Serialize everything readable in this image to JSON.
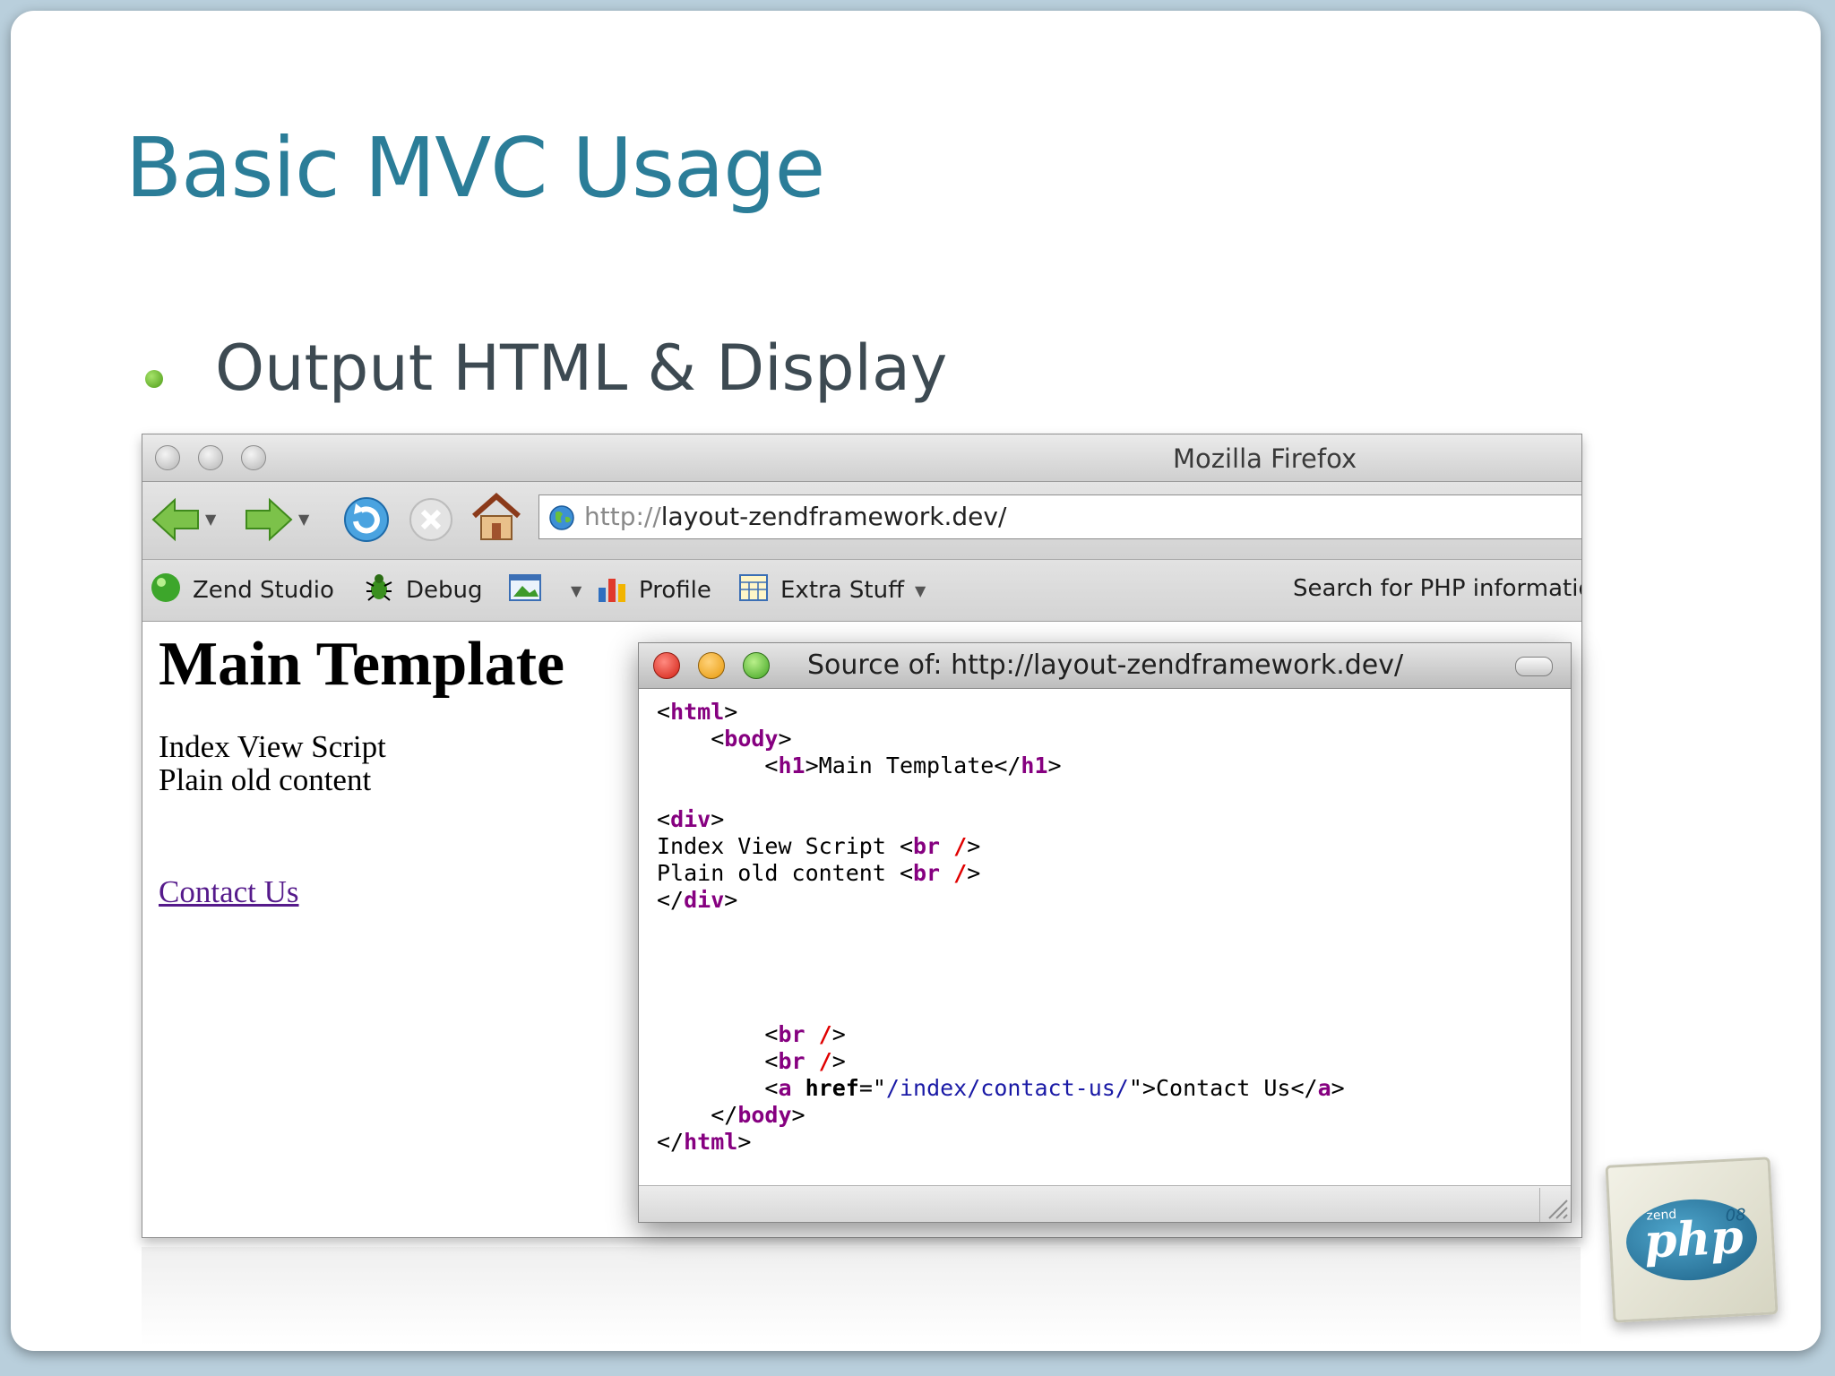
{
  "slide": {
    "title": "Basic MVC Usage",
    "bullet": "Output HTML & Display"
  },
  "browser": {
    "window_title": "Mozilla Firefox",
    "url_prefix": "http://",
    "url_rest": "layout-zendframework.dev/",
    "bookmarks": {
      "zend_studio": "Zend Studio",
      "debug": "Debug",
      "profile": "Profile",
      "extra_stuff": "Extra Stuff",
      "search": "Search for PHP informatio"
    },
    "page": {
      "heading": "Main Template",
      "line1": "Index View Script",
      "line2": "Plain old content",
      "link": "Contact Us"
    }
  },
  "source_window": {
    "title": "Source of: http://layout-zendframework.dev/",
    "code": {
      "h1_text": "Main Template",
      "line1": "Index View Script ",
      "line2": "Plain old content ",
      "href": "/index/contact-us/",
      "link_text": "Contact Us"
    }
  },
  "logo": {
    "zend": "zend",
    "php": "php",
    "year": "08"
  },
  "colors": {
    "title": "#2b7d98",
    "bullet": "#6fbf2e",
    "link": "#551a8b",
    "source_tag": "#860080",
    "source_value": "#1a1aa6",
    "source_slash": "#e00000"
  }
}
